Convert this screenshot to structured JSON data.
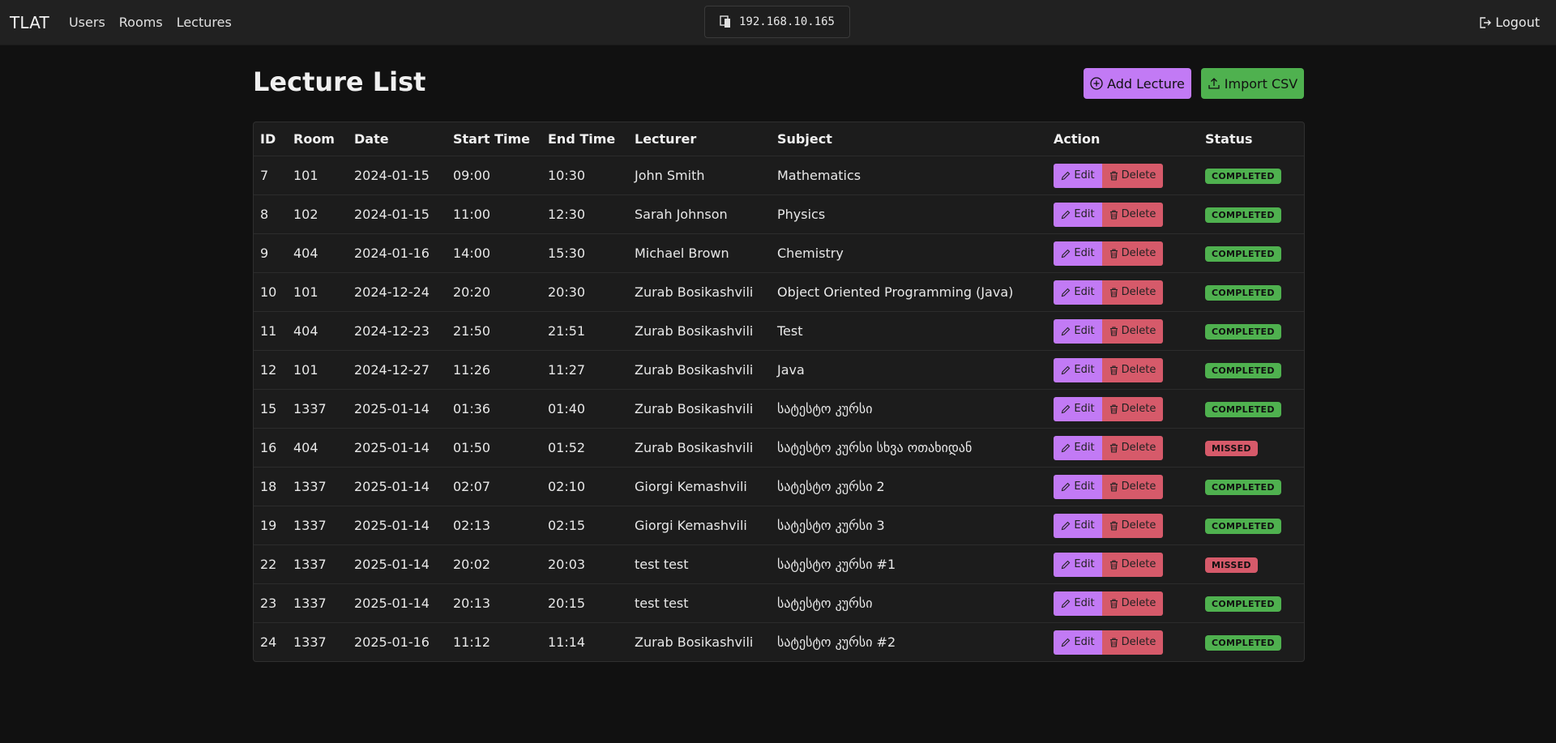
{
  "navbar": {
    "brand": "TLAT",
    "links": [
      "Users",
      "Rooms",
      "Lectures"
    ],
    "ip": "192.168.10.165",
    "logout": "Logout"
  },
  "page": {
    "title": "Lecture List",
    "add_label": "Add Lecture",
    "import_label": "Import CSV"
  },
  "table": {
    "headers": [
      "ID",
      "Room",
      "Date",
      "Start Time",
      "End Time",
      "Lecturer",
      "Subject",
      "Action",
      "Status"
    ],
    "edit_label": "Edit",
    "delete_label": "Delete",
    "rows": [
      {
        "id": "7",
        "room": "101",
        "date": "2024-01-15",
        "start": "09:00",
        "end": "10:30",
        "lecturer": "John Smith",
        "subject": "Mathematics",
        "status": "COMPLETED"
      },
      {
        "id": "8",
        "room": "102",
        "date": "2024-01-15",
        "start": "11:00",
        "end": "12:30",
        "lecturer": "Sarah Johnson",
        "subject": "Physics",
        "status": "COMPLETED"
      },
      {
        "id": "9",
        "room": "404",
        "date": "2024-01-16",
        "start": "14:00",
        "end": "15:30",
        "lecturer": "Michael Brown",
        "subject": "Chemistry",
        "status": "COMPLETED"
      },
      {
        "id": "10",
        "room": "101",
        "date": "2024-12-24",
        "start": "20:20",
        "end": "20:30",
        "lecturer": "Zurab Bosikashvili",
        "subject": "Object Oriented Programming (Java)",
        "status": "COMPLETED"
      },
      {
        "id": "11",
        "room": "404",
        "date": "2024-12-23",
        "start": "21:50",
        "end": "21:51",
        "lecturer": "Zurab Bosikashvili",
        "subject": "Test",
        "status": "COMPLETED"
      },
      {
        "id": "12",
        "room": "101",
        "date": "2024-12-27",
        "start": "11:26",
        "end": "11:27",
        "lecturer": "Zurab Bosikashvili",
        "subject": "Java",
        "status": "COMPLETED"
      },
      {
        "id": "15",
        "room": "1337",
        "date": "2025-01-14",
        "start": "01:36",
        "end": "01:40",
        "lecturer": "Zurab Bosikashvili",
        "subject": "სატესტო კურსი",
        "status": "COMPLETED"
      },
      {
        "id": "16",
        "room": "404",
        "date": "2025-01-14",
        "start": "01:50",
        "end": "01:52",
        "lecturer": "Zurab Bosikashvili",
        "subject": "სატესტო კურსი სხვა ოთახიდან",
        "status": "MISSED"
      },
      {
        "id": "18",
        "room": "1337",
        "date": "2025-01-14",
        "start": "02:07",
        "end": "02:10",
        "lecturer": "Giorgi Kemashvili",
        "subject": "სატესტო კურსი 2",
        "status": "COMPLETED"
      },
      {
        "id": "19",
        "room": "1337",
        "date": "2025-01-14",
        "start": "02:13",
        "end": "02:15",
        "lecturer": "Giorgi Kemashvili",
        "subject": "სატესტო კურსი 3",
        "status": "COMPLETED"
      },
      {
        "id": "22",
        "room": "1337",
        "date": "2025-01-14",
        "start": "20:02",
        "end": "20:03",
        "lecturer": "test test",
        "subject": "სატესტო კურსი #1",
        "status": "MISSED"
      },
      {
        "id": "23",
        "room": "1337",
        "date": "2025-01-14",
        "start": "20:13",
        "end": "20:15",
        "lecturer": "test test",
        "subject": "სატესტო კურსი",
        "status": "COMPLETED"
      },
      {
        "id": "24",
        "room": "1337",
        "date": "2025-01-16",
        "start": "11:12",
        "end": "11:14",
        "lecturer": "Zurab Bosikashvili",
        "subject": "სატესტო კურსი #2",
        "status": "COMPLETED"
      }
    ]
  },
  "colors": {
    "accent_purple": "#c27af5",
    "success_green": "#4fb14f",
    "danger_red": "#d65a6a",
    "background": "#111111",
    "navbar": "#212121"
  },
  "icons": {
    "ip": "network-device-icon",
    "logout": "logout-icon",
    "add": "plus-circle-icon",
    "import": "upload-icon",
    "edit": "pencil-icon",
    "delete": "trash-icon"
  }
}
